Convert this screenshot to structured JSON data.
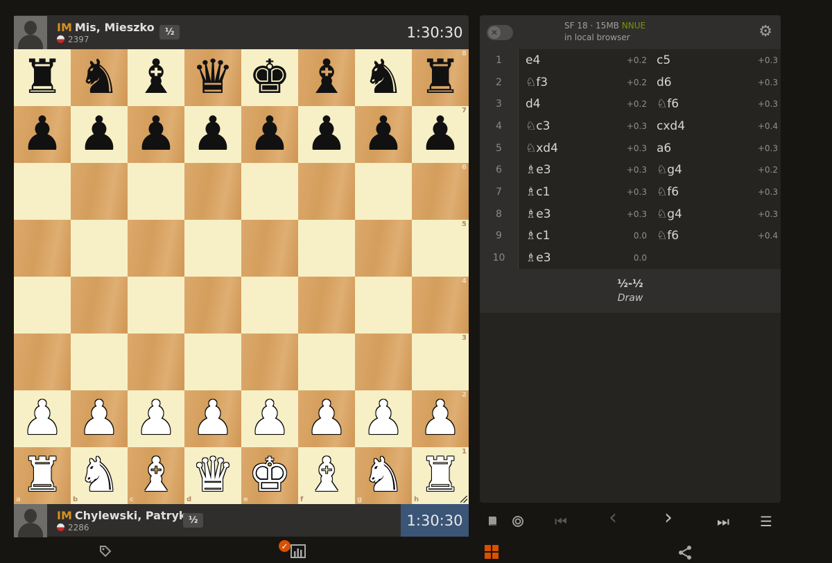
{
  "players": {
    "top": {
      "title": "IM",
      "name": "Mis, Mieszko",
      "rating": "2397",
      "score": "½",
      "clock": "1:30:30"
    },
    "bottom": {
      "title": "IM",
      "name": "Chylewski, Patryk",
      "rating": "2286",
      "score": "½",
      "clock": "1:30:30"
    }
  },
  "board": {
    "ranks": [
      "8",
      "7",
      "6",
      "5",
      "4",
      "3",
      "2",
      "1"
    ],
    "files": [
      "a",
      "b",
      "c",
      "d",
      "e",
      "f",
      "g",
      "h"
    ],
    "position": [
      [
        "bR",
        "bN",
        "bB",
        "bQ",
        "bK",
        "bB",
        "bN",
        "bR"
      ],
      [
        "bP",
        "bP",
        "bP",
        "bP",
        "bP",
        "bP",
        "bP",
        "bP"
      ],
      [
        "",
        "",
        "",
        "",
        "",
        "",
        "",
        ""
      ],
      [
        "",
        "",
        "",
        "",
        "",
        "",
        "",
        ""
      ],
      [
        "",
        "",
        "",
        "",
        "",
        "",
        "",
        ""
      ],
      [
        "",
        "",
        "",
        "",
        "",
        "",
        "",
        ""
      ],
      [
        "wP",
        "wP",
        "wP",
        "wP",
        "wP",
        "wP",
        "wP",
        "wP"
      ],
      [
        "wR",
        "wN",
        "wB",
        "wQ",
        "wK",
        "wB",
        "wN",
        "wR"
      ]
    ]
  },
  "engine": {
    "name": "SF 18 · 15MB",
    "badge": "NNUE",
    "location": "in local browser",
    "enabled": false
  },
  "moves": [
    {
      "n": "1",
      "w": "e4",
      "we": "+0.2",
      "b": "c5",
      "be": "+0.3"
    },
    {
      "n": "2",
      "w": "♘f3",
      "we": "+0.2",
      "b": "d6",
      "be": "+0.3"
    },
    {
      "n": "3",
      "w": "d4",
      "we": "+0.2",
      "b": "♘f6",
      "be": "+0.3"
    },
    {
      "n": "4",
      "w": "♘c3",
      "we": "+0.3",
      "b": "cxd4",
      "be": "+0.4"
    },
    {
      "n": "5",
      "w": "♘xd4",
      "we": "+0.3",
      "b": "a6",
      "be": "+0.3"
    },
    {
      "n": "6",
      "w": "♗e3",
      "we": "+0.3",
      "b": "♘g4",
      "be": "+0.2"
    },
    {
      "n": "7",
      "w": "♗c1",
      "we": "+0.3",
      "b": "♘f6",
      "be": "+0.3"
    },
    {
      "n": "8",
      "w": "♗e3",
      "we": "+0.3",
      "b": "♘g4",
      "be": "+0.3"
    },
    {
      "n": "9",
      "w": "♗c1",
      "we": "0.0",
      "b": "♘f6",
      "be": "+0.4"
    },
    {
      "n": "10",
      "w": "♗e3",
      "we": "0.0",
      "b": "",
      "be": ""
    }
  ],
  "result": {
    "score": "½-½",
    "text": "Draw"
  },
  "controls": {
    "book": "opening-book-icon",
    "practice": "target-icon",
    "first": "⏮",
    "prev": "‹",
    "next": "›",
    "last": "⏭",
    "menu": "☰"
  },
  "colors": {
    "accent_title": "#d59120",
    "nnue": "#759900",
    "active_clock": "#3b5577",
    "badge": "#d85000"
  }
}
